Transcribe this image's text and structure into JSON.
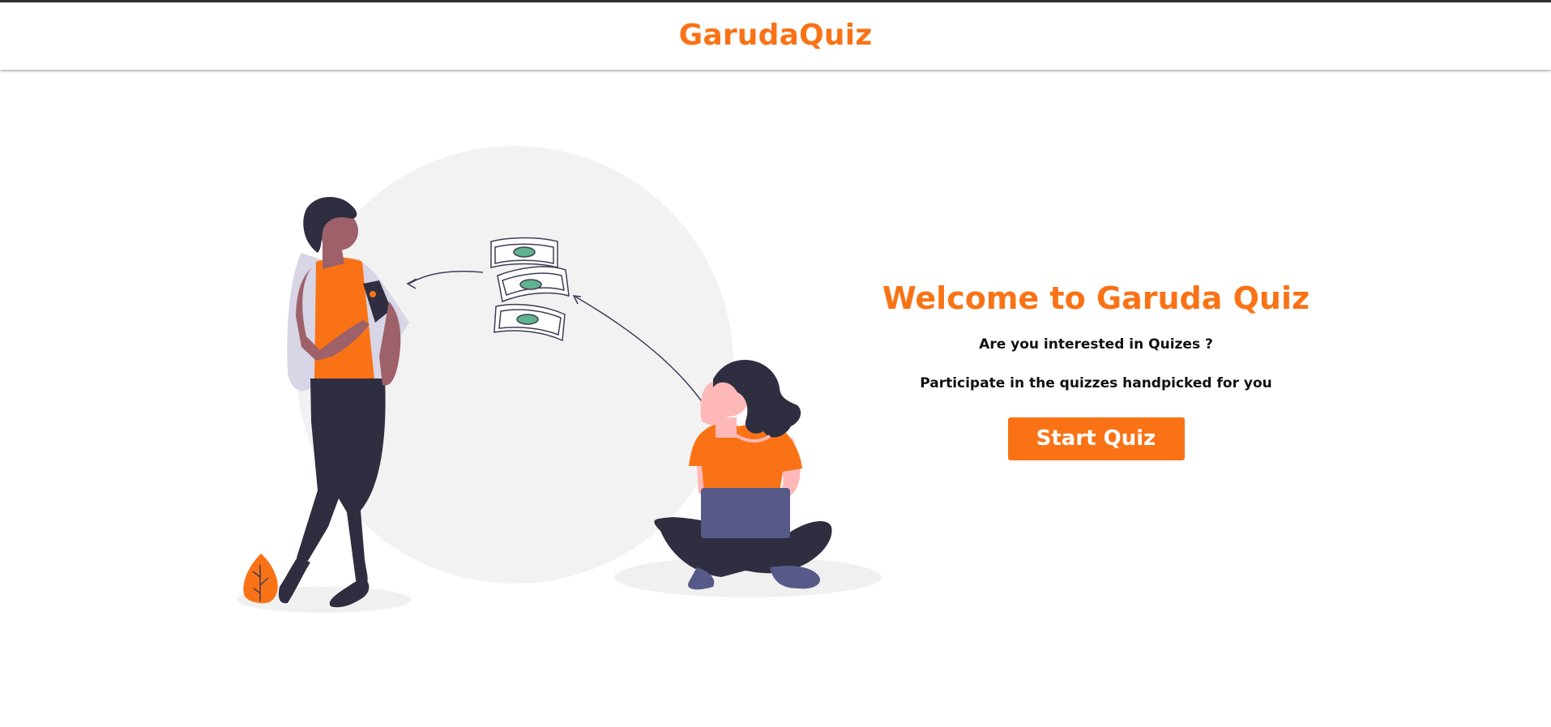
{
  "navbar": {
    "brand": "GarudaQuiz"
  },
  "hero": {
    "title": "Welcome to Garuda Quiz",
    "line1": "Are you interested in Quizes ?",
    "line2": "Participate in the quizzes handpicked for you",
    "button": "Start Quiz"
  },
  "colors": {
    "accent": "#f97316",
    "ink": "#2f2e41",
    "bg_circle": "#f2f2f2",
    "money_green": "#5fb38f"
  },
  "illustration": {
    "icon": "people-exchanging-money-illustration"
  }
}
